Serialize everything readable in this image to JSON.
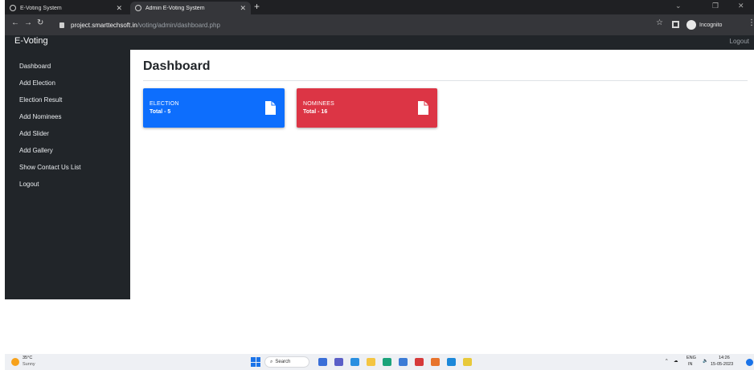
{
  "browser": {
    "tabs": [
      {
        "title": "E-Voting System",
        "active": false
      },
      {
        "title": "Admin E-Voting System",
        "active": true
      }
    ],
    "new_tab_symbol": "+",
    "url_host": "project.smarttechsoft.in",
    "url_path": "/voting/admin/dashboard.php",
    "profile_label": "Incognito",
    "icons": [
      "back-arrow-icon",
      "forward-arrow-icon",
      "reload-icon",
      "lock-icon",
      "star-icon",
      "side-panel-icon",
      "incognito-icon",
      "kebab-menu-icon"
    ]
  },
  "navbar": {
    "brand": "E-Voting",
    "logout": "Logout"
  },
  "sidebar": {
    "items": [
      {
        "label": "Dashboard"
      },
      {
        "label": "Add Election"
      },
      {
        "label": "Election Result"
      },
      {
        "label": "Add Nominees"
      },
      {
        "label": "Add Slider"
      },
      {
        "label": "Add Gallery"
      },
      {
        "label": "Show Contact Us List"
      },
      {
        "label": "Logout"
      }
    ]
  },
  "main": {
    "title": "Dashboard",
    "cards": [
      {
        "label": "ELECTION",
        "total": "Total - 5",
        "color": "#0d6efd",
        "icon": "file-icon"
      },
      {
        "label": "NOMINEES",
        "total": "Total - 16",
        "color": "#dc3545",
        "icon": "file-icon"
      }
    ]
  },
  "taskbar": {
    "weather_temp": "35°C",
    "weather_cond": "Sunny",
    "search_label": "Search",
    "lang_top": "ENG",
    "lang_bottom": "IN",
    "time": "14:26",
    "date": "15-05-2023"
  },
  "colors": {
    "sidebar_bg": "#212529",
    "primary": "#0d6efd",
    "danger": "#dc3545"
  }
}
